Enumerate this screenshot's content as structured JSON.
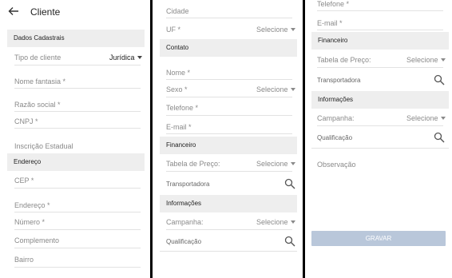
{
  "screen1": {
    "title": "Cliente",
    "sec_dados": "Dados Cadastrais",
    "tipo_label": "Tipo de cliente",
    "tipo_value": "Jurídica",
    "nome_fantasia": "Nome fantasia *",
    "razao_social": "Razão social *",
    "cnpj": "CNPJ *",
    "inscricao": "Inscrição Estadual",
    "sec_endereco": "Endereço",
    "cep": "CEP *",
    "endereco": "Endereço *",
    "numero": "Número *",
    "complemento": "Complemento",
    "bairro": "Bairro"
  },
  "screen2": {
    "cidade": "Cidade",
    "uf": "UF *",
    "uf_select": "Selecione",
    "sec_contato": "Contato",
    "nome": "Nome *",
    "sexo": "Sexo *",
    "sexo_select": "Selecione",
    "telefone": "Telefone *",
    "email": "E-mail *",
    "sec_financeiro": "Financeiro",
    "tabela": "Tabela de Preço:",
    "tabela_select": "Selecione",
    "transportadora": "Transportadora",
    "sec_informacoes": "Informações",
    "campanha": "Campanha:",
    "campanha_select": "Selecione",
    "qualificacao": "Qualificação"
  },
  "screen3": {
    "telefone": "Telefone *",
    "email": "E-mail *",
    "sec_financeiro": "Financeiro",
    "tabela": "Tabela de Preço:",
    "tabela_select": "Selecione",
    "transportadora": "Transportadora",
    "sec_informacoes": "Informações",
    "campanha": "Campanha:",
    "campanha_select": "Selecione",
    "qualificacao": "Qualificação",
    "observacao": "Observação",
    "gravar": "GRAVAR"
  },
  "colors": {
    "section_bg": "#eeeeee",
    "button_bg": "#b9c7da",
    "divider": "#000000"
  }
}
